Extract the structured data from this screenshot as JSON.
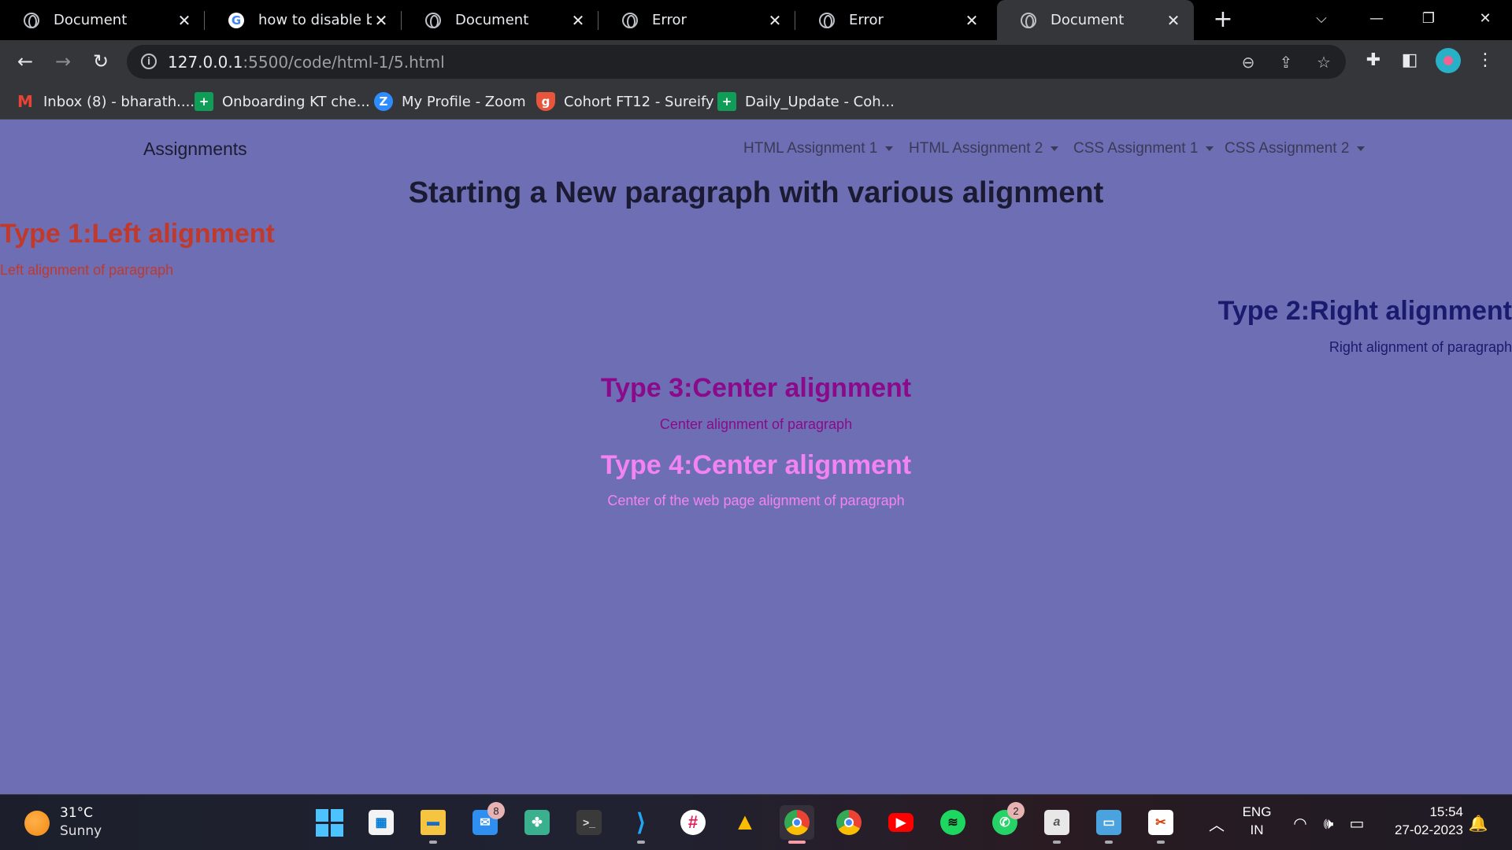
{
  "browser": {
    "tabs": [
      {
        "title": "Document",
        "favicon": "globe-icon",
        "active": false
      },
      {
        "title": "how to disable boo",
        "favicon": "google-icon",
        "active": false
      },
      {
        "title": "Document",
        "favicon": "globe-icon",
        "active": false
      },
      {
        "title": "Error",
        "favicon": "globe-icon",
        "active": false
      },
      {
        "title": "Error",
        "favicon": "globe-icon",
        "active": false
      },
      {
        "title": "Document",
        "favicon": "globe-icon",
        "active": true
      }
    ],
    "close_glyph": "✕",
    "new_tab_glyph": "+",
    "url_host": "127.0.0.1",
    "url_rest": ":5500/code/html-1/5.html",
    "bookmarks": [
      {
        "label": "Inbox (8) - bharath....",
        "icon": "gmail-icon"
      },
      {
        "label": "Onboarding KT che...",
        "icon": "sheets-icon"
      },
      {
        "label": "My Profile - Zoom",
        "icon": "zoom-icon"
      },
      {
        "label": "Cohort FT12 - Sureify",
        "icon": "shield-icon"
      },
      {
        "label": "Daily_Update - Coh...",
        "icon": "sheets-icon"
      }
    ]
  },
  "page": {
    "background": "#6e6eb4",
    "brand": "Assignments",
    "nav": [
      "HTML Assignment 1",
      "HTML Assignment 2",
      "CSS Assignment 1",
      "CSS Assignment 2"
    ],
    "heading": "Starting a New paragraph with various alignment",
    "sections": [
      {
        "title": "Type 1:Left alignment",
        "text": "Left alignment of paragraph",
        "color": "#c0392b"
      },
      {
        "title": "Type 2:Right alignment",
        "text": "Right alignment of paragraph",
        "color": "#1a1a6e"
      },
      {
        "title": "Type 3:Center alignment",
        "text": "Center alignment of paragraph",
        "color": "#8b0a8b"
      },
      {
        "title": "Type 4:Center alignment",
        "text": "Center of the web page alignment of paragraph",
        "color": "#f383f3"
      }
    ]
  },
  "taskbar": {
    "weather_temp": "31°C",
    "weather_desc": "Sunny",
    "mail_badge": "8",
    "whatsapp_badge": "2",
    "lang_line1": "ENG",
    "lang_line2": "IN",
    "time": "15:54",
    "date": "27-02-2023"
  }
}
